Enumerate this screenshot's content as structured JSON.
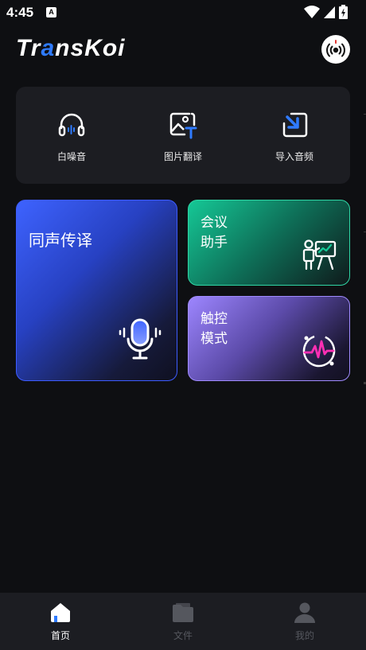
{
  "status_bar": {
    "time": "4:45",
    "app_badge": "A"
  },
  "header": {
    "logo_prefix": "Tr",
    "logo_accent": "a",
    "logo_suffix": "nsKoi"
  },
  "tools": [
    {
      "label": "白噪音",
      "icon": "headphones-icon"
    },
    {
      "label": "图片翻译",
      "icon": "image-translate-icon"
    },
    {
      "label": "导入音频",
      "icon": "import-audio-icon"
    }
  ],
  "cards": {
    "interpret": {
      "title": "同声传译",
      "icon": "microphone-icon",
      "color": "#3e63ff"
    },
    "meeting": {
      "title_line1": "会议",
      "title_line2": "助手",
      "icon": "presentation-icon",
      "color": "#15c896"
    },
    "touch": {
      "title_line1": "触控",
      "title_line2": "模式",
      "icon": "waveform-icon",
      "color": "#9d86ff"
    }
  },
  "bottom_nav": [
    {
      "label": "首页",
      "icon": "home-icon",
      "active": true
    },
    {
      "label": "文件",
      "icon": "folder-icon",
      "active": false
    },
    {
      "label": "我的",
      "icon": "profile-icon",
      "active": false
    }
  ],
  "colors": {
    "background": "#0e0f12",
    "panel": "#1c1d22",
    "accent": "#2f7bff"
  }
}
